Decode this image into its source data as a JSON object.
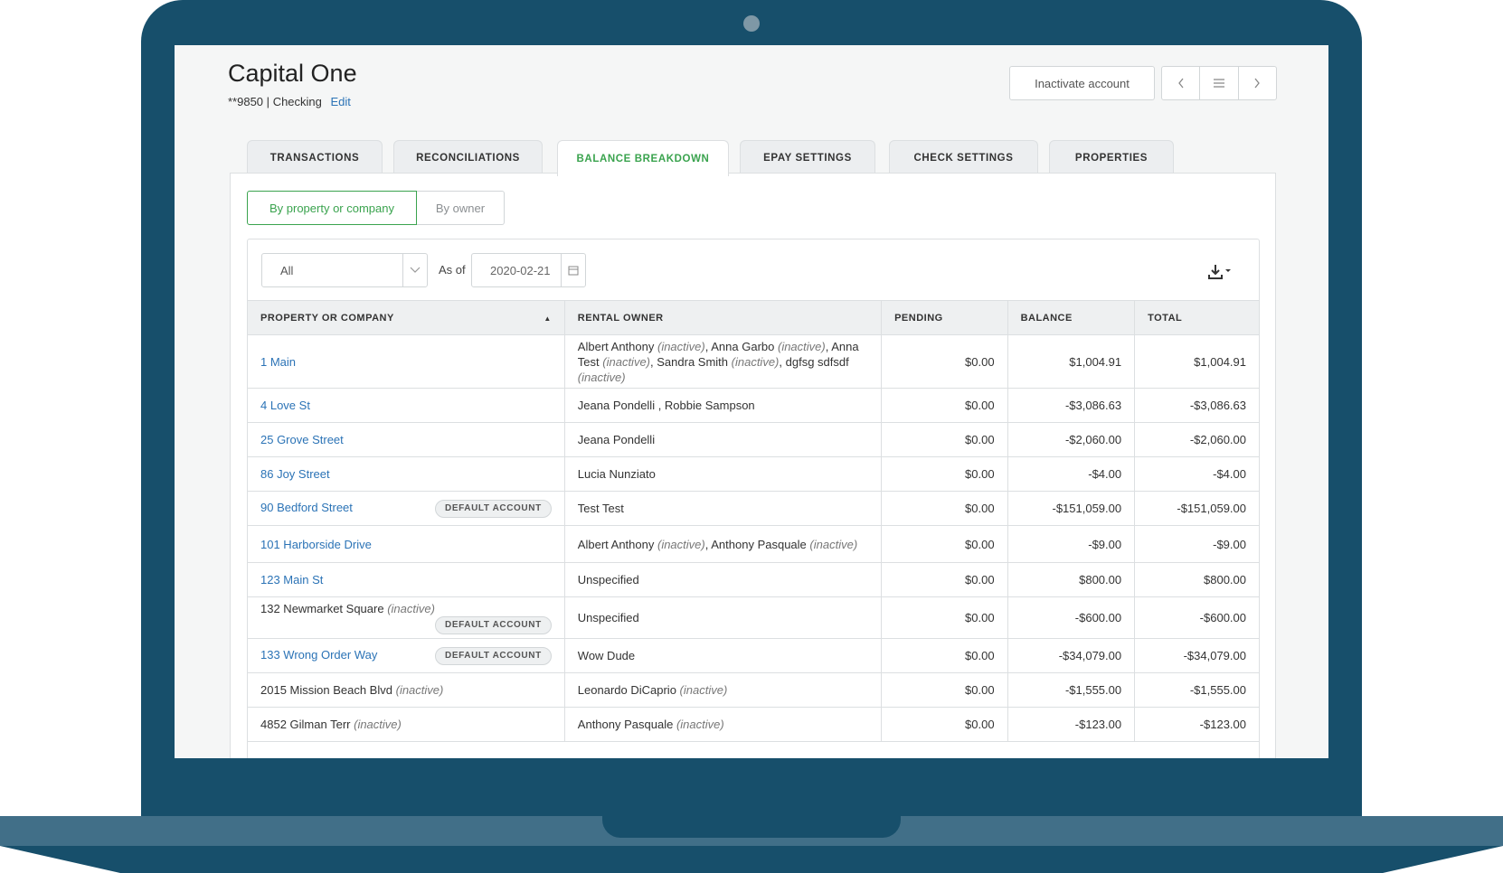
{
  "account": {
    "name": "Capital One",
    "number": "**9850",
    "separator": "|",
    "type": "Checking",
    "edit_label": "Edit"
  },
  "actions": {
    "inactivate_label": "Inactivate account",
    "prev_icon": "chevron-left-icon",
    "list_icon": "list-icon",
    "next_icon": "chevron-right-icon"
  },
  "tabs": [
    {
      "label": "TRANSACTIONS"
    },
    {
      "label": "RECONCILIATIONS"
    },
    {
      "label": "BALANCE BREAKDOWN",
      "active": true
    },
    {
      "label": "EPAY SETTINGS"
    },
    {
      "label": "CHECK SETTINGS"
    },
    {
      "label": "PROPERTIES"
    }
  ],
  "view_toggle": {
    "by_property": "By property or company",
    "by_owner": "By owner"
  },
  "filters": {
    "scope_value": "All",
    "as_of_label": "As of",
    "date_value": "2020-02-21"
  },
  "table": {
    "headers": [
      "PROPERTY OR COMPANY",
      "RENTAL OWNER",
      "PENDING",
      "BALANCE",
      "TOTAL"
    ],
    "badge_label": "DEFAULT ACCOUNT",
    "inactive_label": "(inactive)",
    "rows": [
      {
        "property": "1 Main",
        "owner_html": [
          [
            "Albert Anthony",
            true
          ],
          [
            "Anna Garbo",
            true
          ],
          [
            "Anna Test",
            true
          ],
          [
            "Sandra Smith",
            true
          ],
          [
            "dgfsg sdfsdf",
            true
          ]
        ],
        "pending": "$0.00",
        "balance": "$1,004.91",
        "total": "$1,004.91"
      },
      {
        "property": "4 Love St",
        "owner": "Jeana Pondelli , Robbie Sampson",
        "pending": "$0.00",
        "balance": "-$3,086.63",
        "total": "-$3,086.63"
      },
      {
        "property": "25 Grove Street",
        "owner": "Jeana Pondelli",
        "pending": "$0.00",
        "balance": "-$2,060.00",
        "total": "-$2,060.00"
      },
      {
        "property": "86 Joy Street",
        "owner": "Lucia Nunziato",
        "pending": "$0.00",
        "balance": "-$4.00",
        "total": "-$4.00"
      },
      {
        "property": "90 Bedford Street",
        "badge": true,
        "owner": "Test Test",
        "pending": "$0.00",
        "balance": "-$151,059.00",
        "total": "-$151,059.00"
      },
      {
        "property": "101 Harborside Drive",
        "owner_html": [
          [
            "Albert Anthony",
            true
          ],
          [
            "Anthony Pasquale",
            true
          ]
        ],
        "pending": "$0.00",
        "balance": "-$9.00",
        "total": "-$9.00"
      },
      {
        "property": "123 Main St",
        "owner": "Unspecified",
        "pending": "$0.00",
        "balance": "$800.00",
        "total": "$800.00"
      },
      {
        "property": "132 Newmarket Square",
        "property_inactive": true,
        "badge": true,
        "badge_below": true,
        "owner": "Unspecified",
        "pending": "$0.00",
        "balance": "-$600.00",
        "total": "-$600.00"
      },
      {
        "property": "133 Wrong Order Way",
        "badge": true,
        "owner": "Wow Dude",
        "pending": "$0.00",
        "balance": "-$34,079.00",
        "total": "-$34,079.00"
      },
      {
        "property": "2015 Mission Beach Blvd",
        "property_inactive": true,
        "owner_html": [
          [
            "Leonardo DiCaprio",
            true
          ]
        ],
        "pending": "$0.00",
        "balance": "-$1,555.00",
        "total": "-$1,555.00"
      },
      {
        "property": "4852 Gilman Terr",
        "property_inactive": true,
        "owner_html": [
          [
            "Anthony Pasquale",
            true
          ]
        ],
        "pending": "$0.00",
        "balance": "-$123.00",
        "total": "-$123.00"
      }
    ]
  },
  "icons": {
    "dropdown": "chevron-down-icon",
    "calendar": "calendar-icon",
    "download": "download-icon",
    "sort": "sort-asc-icon"
  },
  "colors": {
    "frame": "#174f6b",
    "accent_green": "#3aa34e",
    "link_blue": "#2b73b6"
  }
}
